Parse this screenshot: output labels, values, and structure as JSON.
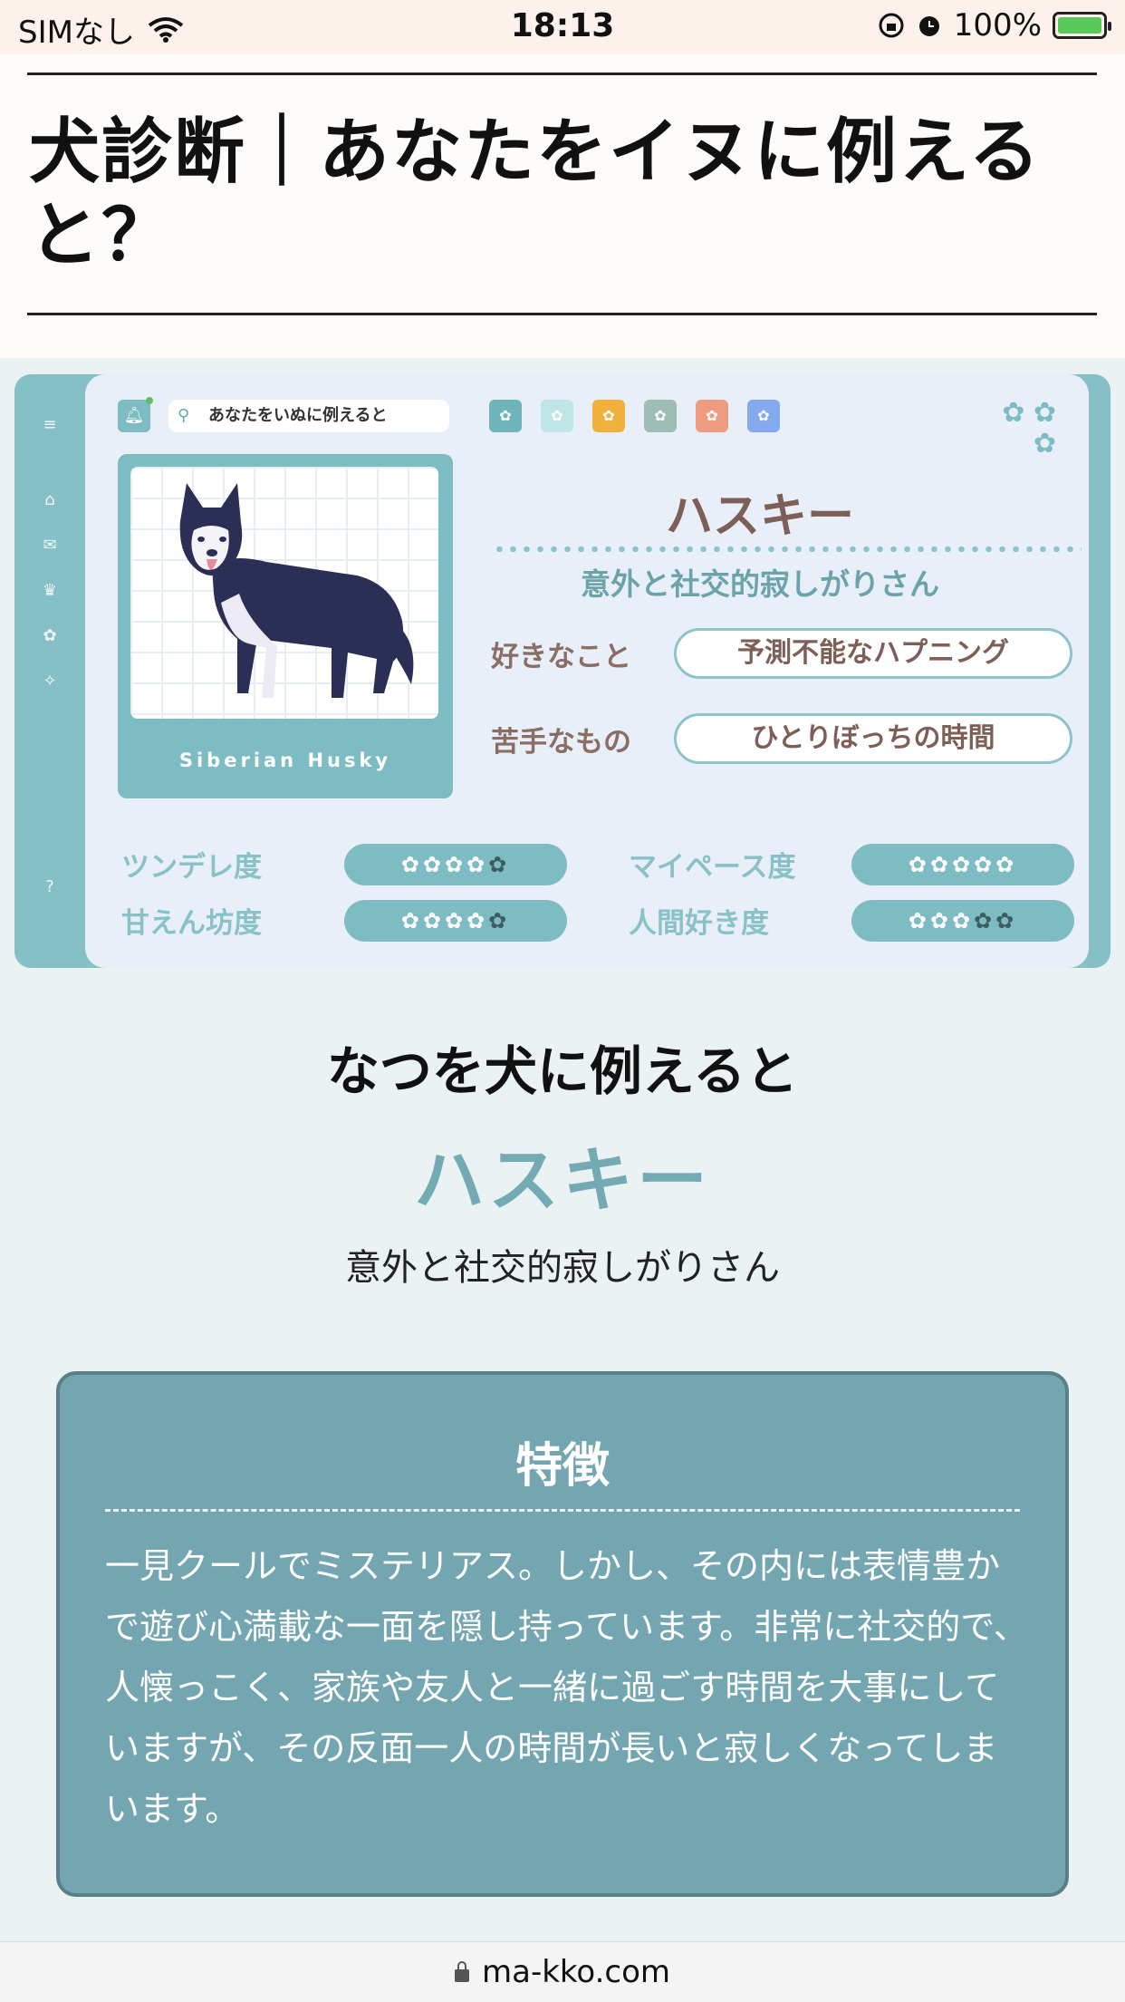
{
  "status_bar": {
    "carrier": "SIMなし",
    "time": "18:13",
    "battery": "100%"
  },
  "header": {
    "title": "犬診断｜あなたをイヌに例えると？"
  },
  "card": {
    "search_text": "あなたをいぬに例えると",
    "swatch_colors": [
      "#6fb3bb",
      "#bfe6e6",
      "#f2b13c",
      "#9dbdb5",
      "#ef9b7f",
      "#84a9ee"
    ],
    "photo_caption": "Siberian Husky",
    "breed_name": "ハスキー",
    "breed_subtitle": "意外と社交的寂しがりさん",
    "likes_label": "好きなこと",
    "likes_value": "予測不能なハプニング",
    "dislikes_label": "苦手なもの",
    "dislikes_value": "ひとりぼっちの時間",
    "stats": [
      {
        "label": "ツンデレ度",
        "level": 4,
        "max": 5
      },
      {
        "label": "マイペース度",
        "level": 5,
        "max": 5
      },
      {
        "label": "甘えん坊度",
        "level": 4,
        "max": 5
      },
      {
        "label": "人間好き度",
        "level": 3,
        "max": 5
      }
    ]
  },
  "result": {
    "lead": "なつを犬に例えると",
    "name": "ハスキー",
    "subtitle": "意外と社交的寂しがりさん"
  },
  "features": {
    "heading": "特徴",
    "body": "一見クールでミステリアス。しかし、その内には表情豊かで遊び心満載な一面を隠し持っています。非常に社交的で、人懐っこく、家族や友人と一緒に過ごす時間を大事にしていますが、その反面一人の時間が長いと寂しくなってしまいます。"
  },
  "url_bar": {
    "domain": "ma-kko.com"
  }
}
